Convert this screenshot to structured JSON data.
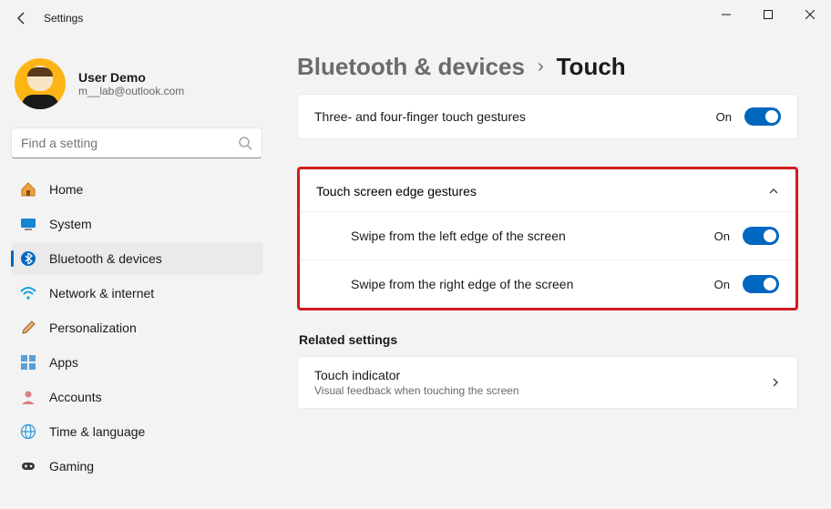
{
  "titlebar": {
    "title": "Settings"
  },
  "user": {
    "name": "User Demo",
    "email": "m__lab@outlook.com"
  },
  "search": {
    "placeholder": "Find a setting"
  },
  "nav": [
    {
      "label": "Home",
      "key": "home"
    },
    {
      "label": "System",
      "key": "system"
    },
    {
      "label": "Bluetooth & devices",
      "key": "bt"
    },
    {
      "label": "Network & internet",
      "key": "net"
    },
    {
      "label": "Personalization",
      "key": "pers"
    },
    {
      "label": "Apps",
      "key": "apps"
    },
    {
      "label": "Accounts",
      "key": "acct"
    },
    {
      "label": "Time & language",
      "key": "time"
    },
    {
      "label": "Gaming",
      "key": "game"
    }
  ],
  "breadcrumb": {
    "parent": "Bluetooth & devices",
    "current": "Touch"
  },
  "settings": {
    "multifinger": {
      "label": "Three- and four-finger touch gestures",
      "state": "On",
      "on": true
    },
    "edge_gestures": {
      "title": "Touch screen edge gestures",
      "expanded": true,
      "left": {
        "label": "Swipe from the left edge of the screen",
        "state": "On",
        "on": true
      },
      "right": {
        "label": "Swipe from the right edge of the screen",
        "state": "On",
        "on": true
      }
    }
  },
  "related": {
    "title": "Related settings",
    "touch_indicator": {
      "title": "Touch indicator",
      "subtitle": "Visual feedback when touching the screen"
    }
  },
  "colors": {
    "accent": "#0067c0",
    "highlight": "#d21c1c"
  }
}
